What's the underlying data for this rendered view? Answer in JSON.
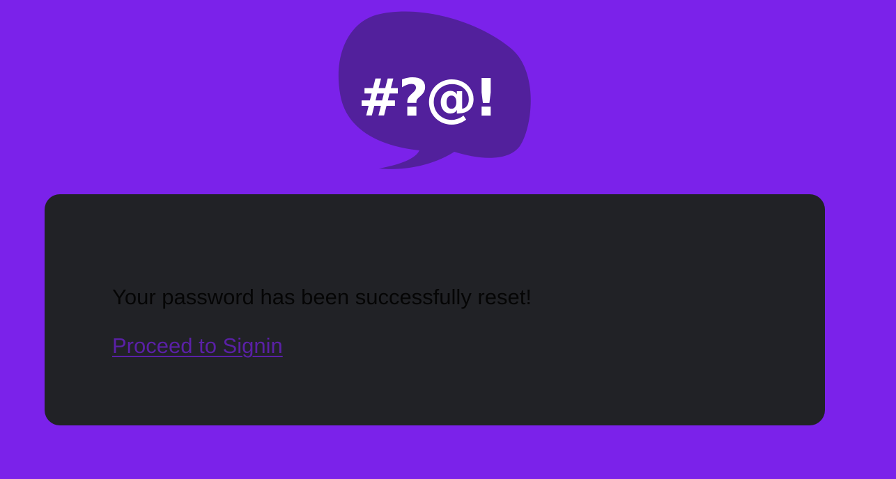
{
  "logo": {
    "glyphs": "#?@!",
    "bubble_color": "#52209c",
    "glyph_color": "#ffffff"
  },
  "colors": {
    "background": "#7b22ea",
    "card": "#212226",
    "message_text": "#050505",
    "link": "#5a20a6"
  },
  "card": {
    "message": "Your password has been successfully reset!",
    "signin_link": "Proceed to Signin"
  }
}
